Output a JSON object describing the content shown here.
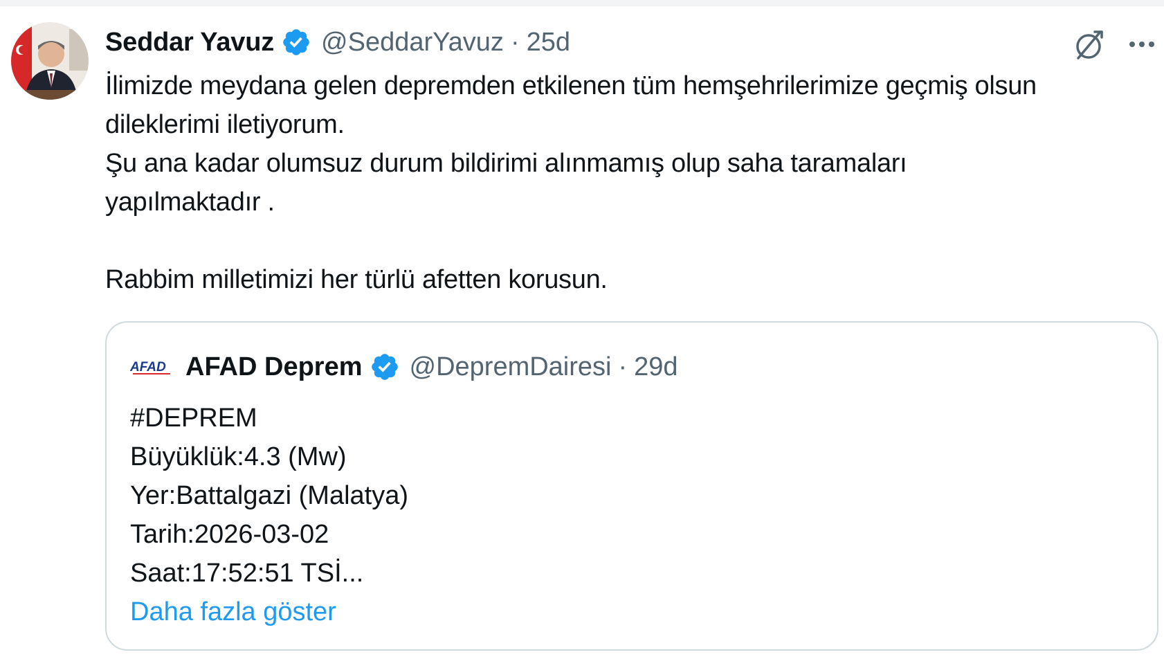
{
  "tweet": {
    "author": {
      "name": "Seddar Yavuz",
      "handle": "@SeddarYavuz",
      "separator": "·",
      "time": "25d",
      "avatar": "profile-photo"
    },
    "text": "İlimizde meydana gelen depremden etkilenen tüm hemşehrilerimize geçmiş olsun\ndileklerimi iletiyorum.\nŞu ana kadar olumsuz durum bildirimi alınmamış olup saha taramaları\nyapılmaktadır .\n\nRabbim milletimizi her türlü afetten korusun.",
    "icons": {
      "verified": "verified-badge-icon",
      "grok": "grok-icon",
      "more": "more-options-icon"
    }
  },
  "quoted": {
    "logo": "AFAD",
    "name": "AFAD Deprem",
    "handle": "@DepremDairesi",
    "separator": "·",
    "time": "29d",
    "lines": [
      "#DEPREM",
      "Büyüklük:4.3 (Mw)",
      "Yer:Battalgazi (Malatya)",
      "Tarih:2026-03-02",
      "Saat:17:52:51 TSİ..."
    ],
    "show_more": "Daha fazla göster"
  },
  "colors": {
    "verified": "#1d9bf0",
    "link": "#1d9bf0",
    "secondary_text": "#536471",
    "border": "#cfd9de",
    "afad_logo": "#1a3a8c"
  }
}
